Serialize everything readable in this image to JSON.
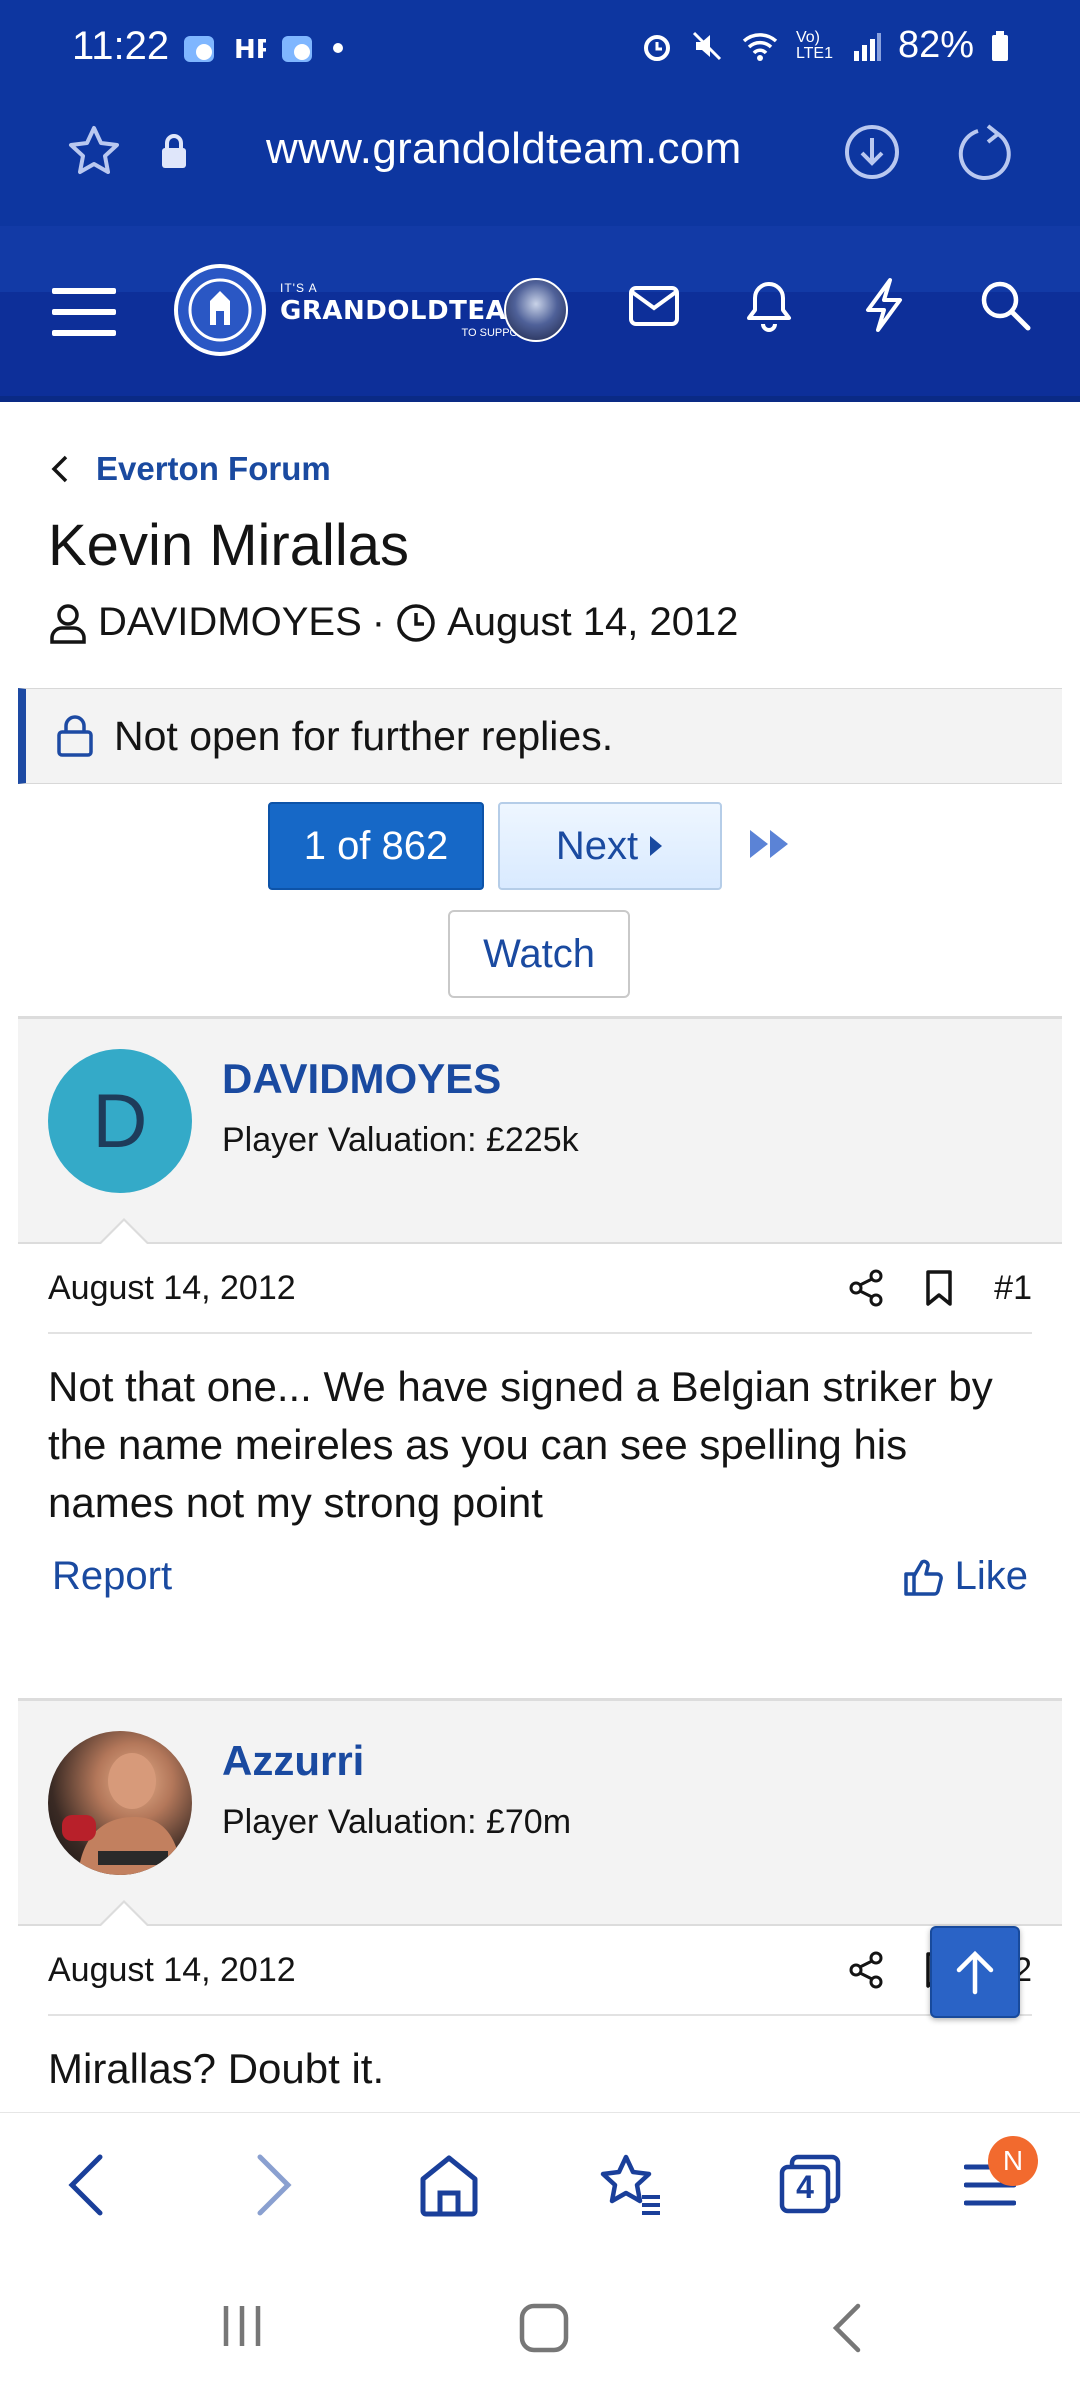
{
  "status_bar": {
    "time": "11:22",
    "battery": "82%",
    "network": "Vo) LTE1"
  },
  "browser": {
    "url": "www.grandoldteam.com",
    "tab_count": "4",
    "menu_badge": "N"
  },
  "site_header": {
    "logo_top": "IT'S A",
    "logo_main": "GRANDOLDTEAM",
    "logo_bottom": "TO SUPPORT"
  },
  "breadcrumb": "Everton Forum",
  "thread": {
    "title": "Kevin Mirallas",
    "author": "DAVIDMOYES",
    "separator": "·",
    "date": "August 14, 2012",
    "locked_notice": "Not open for further replies."
  },
  "pagination": {
    "current": "1 of 862",
    "next_label": "Next"
  },
  "watch_label": "Watch",
  "posts": [
    {
      "username": "DAVIDMOYES",
      "avatar_letter": "D",
      "valuation": "Player Valuation: £225k",
      "date": "August 14, 2012",
      "number": "#1",
      "body": "Not that one... We have signed a Belgian striker by the name meireles as you can see spelling his names not my strong point",
      "report_label": "Report",
      "like_label": "Like"
    },
    {
      "username": "Azzurri",
      "valuation": "Player Valuation: £70m",
      "date": "August 14, 2012",
      "number": "#2",
      "body": "Mirallas? Doubt it."
    }
  ],
  "colors": {
    "header_blue": "#0d36a0",
    "link_blue": "#1a4aa0",
    "page_button": "#1668c7",
    "avatar_teal": "#34aac8",
    "badge_orange": "#f26a2e"
  }
}
